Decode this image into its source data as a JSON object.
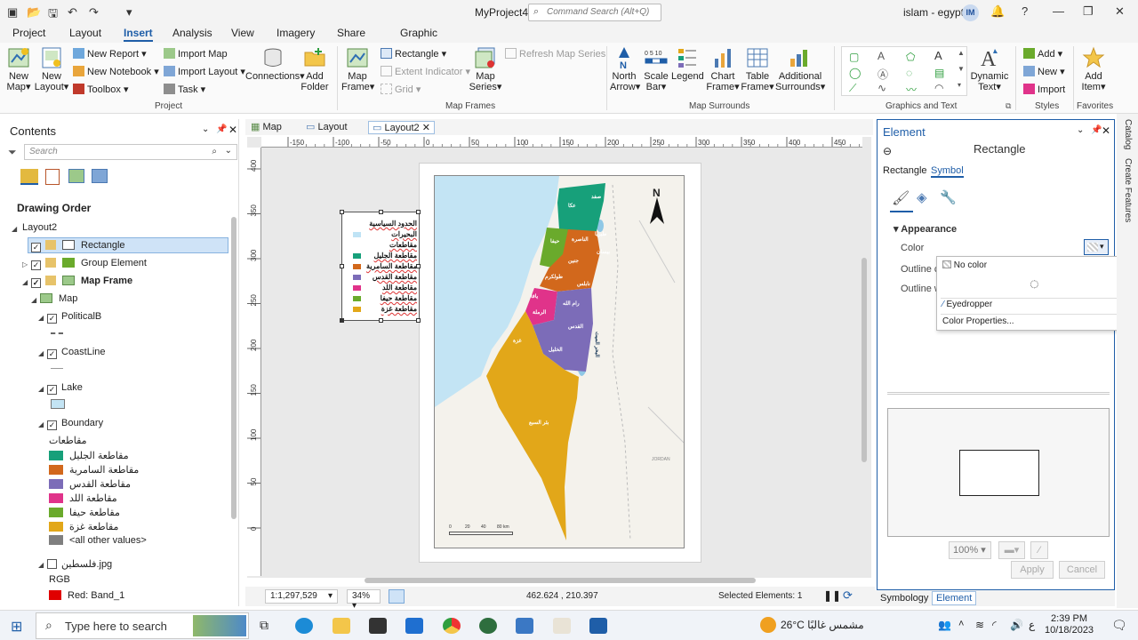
{
  "titlebar": {
    "app_title": "MyProject4",
    "search_placeholder": "Command Search (Alt+Q)",
    "user_name": "islam - egypt",
    "user_initials": "IM",
    "help": "?"
  },
  "ribbon_tabs": [
    "Project",
    "Layout",
    "Insert",
    "Analysis",
    "View",
    "Imagery",
    "Share",
    "Graphic"
  ],
  "ribbon": {
    "project": {
      "label": "Project",
      "new_map": "New Map",
      "new_layout": "New Layout",
      "new_report": "New Report",
      "new_notebook": "New Notebook",
      "toolbox": "Toolbox",
      "import_map": "Import Map",
      "import_layout": "Import Layout",
      "task": "Task",
      "connections": "Connections",
      "add_folder": "Add Folder"
    },
    "map_frames": {
      "label": "Map Frames",
      "map_frame": "Map Frame",
      "rectangle": "Rectangle",
      "extent_indicator": "Extent Indicator",
      "grid": "Grid",
      "map_series": "Map Series",
      "refresh_map_series": "Refresh Map Series"
    },
    "map_surrounds": {
      "label": "Map Surrounds",
      "north_arrow": "North Arrow",
      "scale_bar": "Scale Bar",
      "legend": "Legend",
      "chart_frame": "Chart Frame",
      "table_frame": "Table Frame",
      "additional_surrounds": "Additional Surrounds"
    },
    "graphics_text": {
      "label": "Graphics and Text",
      "dynamic_text": "Dynamic Text"
    },
    "styles": {
      "label": "Styles",
      "add": "Add",
      "new": "New",
      "import": "Import"
    },
    "favorites": {
      "label": "Favorites",
      "add_item": "Add Item"
    }
  },
  "contents": {
    "title": "Contents",
    "search_placeholder": "Search",
    "drawing_order": "Drawing Order",
    "tree": {
      "layout": "Layout2",
      "rectangle": "Rectangle",
      "group_element": "Group Element",
      "map_frame": "Map Frame",
      "map": "Map",
      "political": "PoliticalB",
      "coastline": "CoastLine",
      "lake": "Lake",
      "boundary": "Boundary",
      "boundary_field": "مقاطعات",
      "classes": [
        {
          "label": "مقاطعة الجليل",
          "color": "#17a07a"
        },
        {
          "label": "مقاطعة السامرية",
          "color": "#d2681c"
        },
        {
          "label": "مقاطعة القدس",
          "color": "#7c6cb8"
        },
        {
          "label": "مقاطعة اللد",
          "color": "#e0338a"
        },
        {
          "label": "مقاطعة حيفا",
          "color": "#6aaa2c"
        },
        {
          "label": "مقاطعة غزة",
          "color": "#e2a719"
        },
        {
          "label": "<all other values>",
          "color": "#7f7f7f"
        }
      ],
      "raster": "فلسطين.jpg",
      "rgb": "RGB",
      "red_band": "Red:   Band_1"
    }
  },
  "view_tabs": [
    "Map",
    "Layout",
    "Layout2"
  ],
  "ruler_h": [
    "-150",
    "-100",
    "-50",
    "0",
    "50",
    "100",
    "150",
    "200",
    "250",
    "300",
    "350",
    "400",
    "450"
  ],
  "ruler_v": [
    "400",
    "350",
    "300",
    "250",
    "200",
    "150",
    "100",
    "50",
    "0"
  ],
  "legend_items": [
    {
      "label": "الحدود السياسية",
      "color": null
    },
    {
      "label": "البحيرات",
      "color": "#bfe3f5"
    },
    {
      "label": "مقاطعات",
      "color": null
    },
    {
      "label": "مقاطعة الجليل",
      "color": "#17a07a"
    },
    {
      "label": "مقاطعة السامرية",
      "color": "#d2681c"
    },
    {
      "label": "مقاطعة القدس",
      "color": "#7c6cb8"
    },
    {
      "label": "مقاطعة اللد",
      "color": "#e0338a"
    },
    {
      "label": "مقاطعة حيفا",
      "color": "#6aaa2c"
    },
    {
      "label": "مقاطعة غزة",
      "color": "#e2a719"
    }
  ],
  "map_labels": {
    "north": "N",
    "jordan": "JORDAN",
    "cities": [
      "عكا",
      "صفد",
      "حيفا",
      "طبريا",
      "الناصرة",
      "بيسان",
      "جنين",
      "طولكرم",
      "نابلس",
      "يافا",
      "الرملة",
      "رام الله",
      "القدس",
      "غزة",
      "الخليل",
      "بئر السبع",
      "البحر الميت"
    ],
    "scale": [
      "0",
      "20",
      "40",
      "80 km"
    ]
  },
  "statusbar": {
    "scale": "1:1,297,529",
    "zoom": "34%",
    "coords": "462.624 , 210.397",
    "selected": "Selected Elements: 1"
  },
  "element_pane": {
    "title": "Element",
    "subtitle": "Rectangle",
    "tab_rectangle": "Rectangle",
    "tab_symbol": "Symbol",
    "appearance": "Appearance",
    "color_label": "Color",
    "outline_color_label": "Outline c",
    "outline_width_label": "Outline w",
    "dropdown": {
      "no_color": "No color",
      "eyedropper": "Eyedropper",
      "color_properties": "Color Properties..."
    },
    "zoom": "100%",
    "apply": "Apply",
    "cancel": "Cancel"
  },
  "side_tabs": [
    "Catalog",
    "Create Features"
  ],
  "bottom_tabs": [
    "Symbology",
    "Element"
  ],
  "taskbar": {
    "search": "Type here to search",
    "temperature": "26°C",
    "weather": "مشمس غالبًا",
    "time": "2:39 PM",
    "date": "10/18/2023"
  },
  "colors": {
    "accent": "#1f5ea8",
    "water": "#c3e4f4",
    "land": "#f4f2ec",
    "galilee": "#17a07a",
    "samaria": "#d2681c",
    "jerusalem": "#7c6cb8",
    "lydda": "#e0338a",
    "haifa": "#6aaa2c",
    "gaza": "#e2a719"
  }
}
